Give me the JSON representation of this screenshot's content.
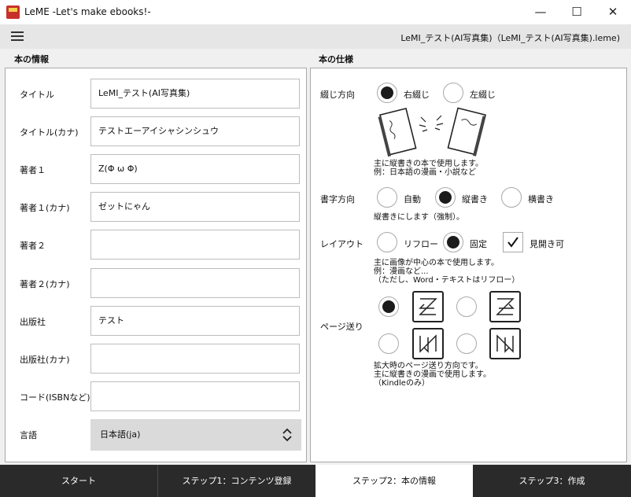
{
  "window": {
    "title": "LeME -Let's make ebooks!-",
    "minimize_glyph": "—",
    "maximize_glyph": "☐",
    "close_glyph": "✕"
  },
  "menubar": {
    "menu_icon": "hamburger-menu-icon",
    "project_path": "LeMI_テスト(AI写真集)（LeMI_テスト(AI写真集).leme)"
  },
  "book_info": {
    "section_title": "本の情報",
    "fields": [
      {
        "label": "タイトル",
        "value": "LeMI_テスト(AI写真集)"
      },
      {
        "label": "タイトル(カナ)",
        "value": "テストエーアイシャシンシュウ"
      },
      {
        "label": "著者１",
        "value": "Z(Φ ω Φ)"
      },
      {
        "label": "著者１(カナ)",
        "value": "ゼットにゃん"
      },
      {
        "label": "著者２",
        "value": ""
      },
      {
        "label": "著者２(カナ)",
        "value": ""
      },
      {
        "label": "出版社",
        "value": "テスト"
      },
      {
        "label": "出版社(カナ)",
        "value": ""
      },
      {
        "label": "コード(ISBNなど)",
        "value": ""
      }
    ],
    "language": {
      "label": "言語",
      "value": "日本語(ja)"
    }
  },
  "book_spec": {
    "section_title": "本の仕様",
    "binding": {
      "label": "綴じ方向",
      "options": [
        "右綴じ",
        "左綴じ"
      ],
      "selected": "右綴じ",
      "note": "主に縦書きの本で使用します。\n例：日本語の漫画・小説など"
    },
    "writing": {
      "label": "書字方向",
      "options": [
        "自動",
        "縦書き",
        "横書き"
      ],
      "selected": "縦書き",
      "note": "縦書きにします（強制）。"
    },
    "layout": {
      "label": "レイアウト",
      "options": [
        "リフロー",
        "固定"
      ],
      "selected": "固定",
      "spread_label": "見開き可",
      "spread_checked": true,
      "note": "主に画像が中心の本で使用します。\n例：漫画など...\n（ただし、Word・テキストはリフロー）"
    },
    "page_turn": {
      "label": "ページ送り",
      "selected_index": 0,
      "note": "拡大時のページ送り方向です。\n主に縦書きの漫画で使用します。\n（Kindleのみ）"
    }
  },
  "steps": {
    "items": [
      "スタート",
      "ステップ1：コンテンツ登録",
      "ステップ2：本の情報",
      "ステップ3：作成"
    ],
    "active_index": 2
  }
}
